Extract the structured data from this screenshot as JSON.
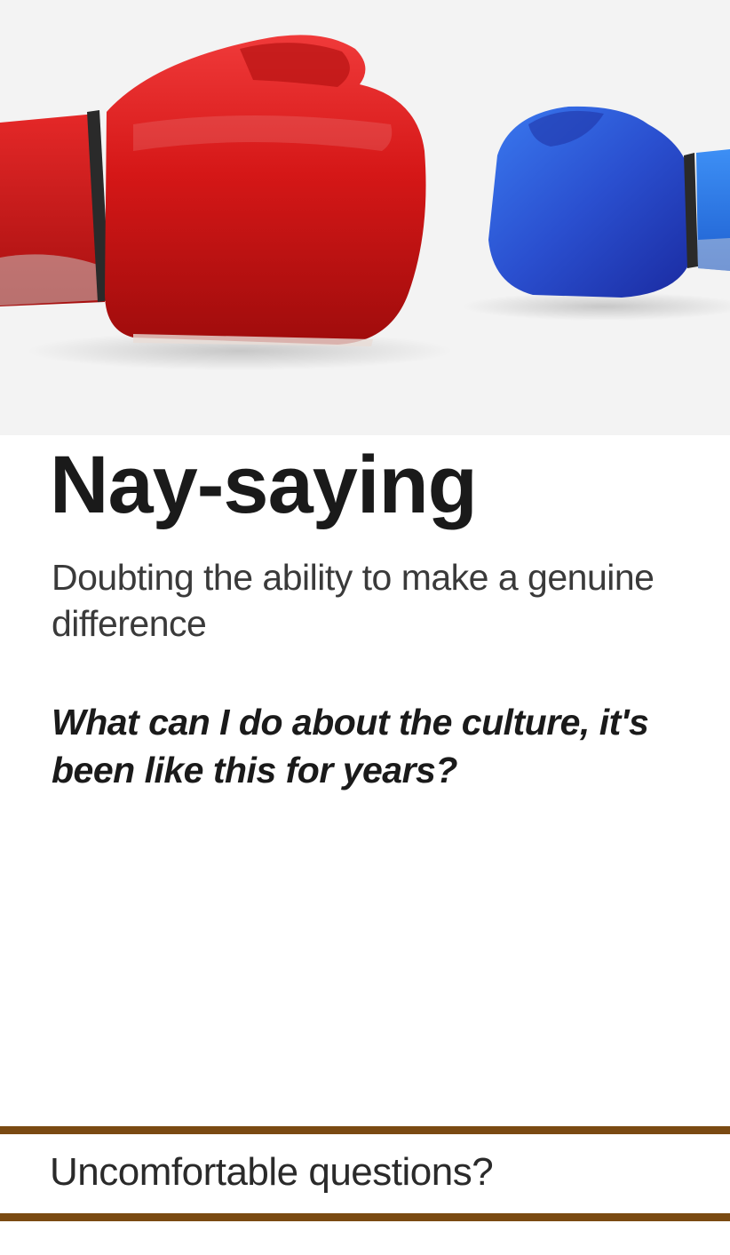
{
  "hero": {
    "image_description_icon": "boxing-gloves-icon",
    "left_glove_color": "#d81c1c",
    "right_glove_color": "#2b5bd6"
  },
  "card": {
    "title": "Nay-saying",
    "subtitle": "Doubting the ability to make a genuine difference",
    "quote": "What can I do about the culture, it's been like this for years?"
  },
  "footer": {
    "label": "Uncomfortable questions?",
    "rule_color": "#7a4a12"
  }
}
